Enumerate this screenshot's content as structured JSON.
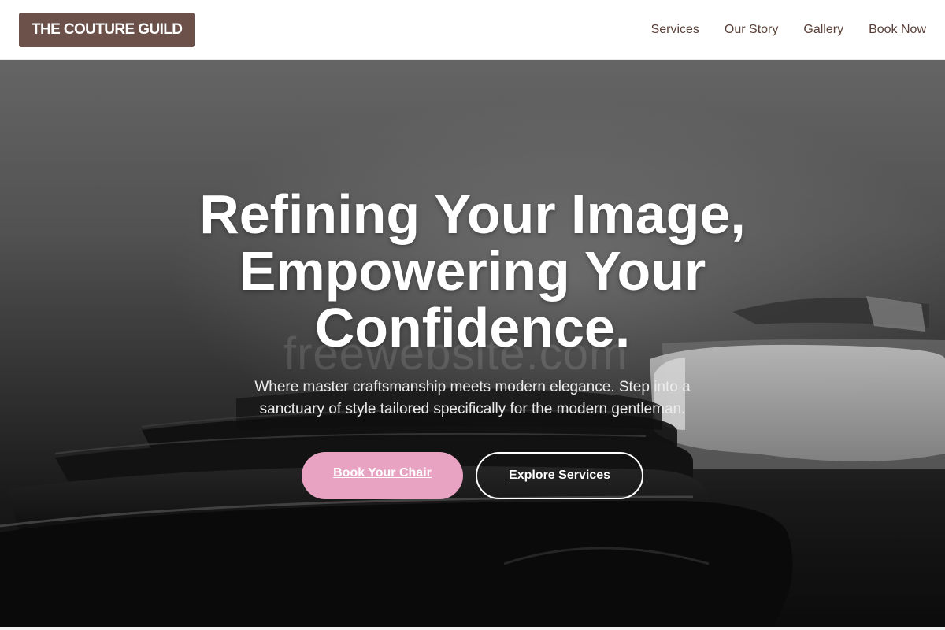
{
  "header": {
    "brand": "THE COUTURE GUILD",
    "nav": [
      {
        "label": "Services"
      },
      {
        "label": "Our Story"
      },
      {
        "label": "Gallery"
      },
      {
        "label": "Book Now"
      }
    ]
  },
  "hero": {
    "headline_lines": [
      "Refining Your Image,",
      "Empowering Your",
      "Confidence."
    ],
    "subtitle": "Where master craftsmanship meets modern elegance. Step into a sanctuary of style tailored specifically for the modern gentleman.",
    "primary_cta": "Book Your Chair",
    "secondary_cta": "Explore Services",
    "watermark": "freewebsite.com"
  },
  "colors": {
    "brand_bg": "#6b5149",
    "nav_text": "#5a4038",
    "primary_cta_bg": "#e7a3c1",
    "hero_text": "#ffffff"
  }
}
